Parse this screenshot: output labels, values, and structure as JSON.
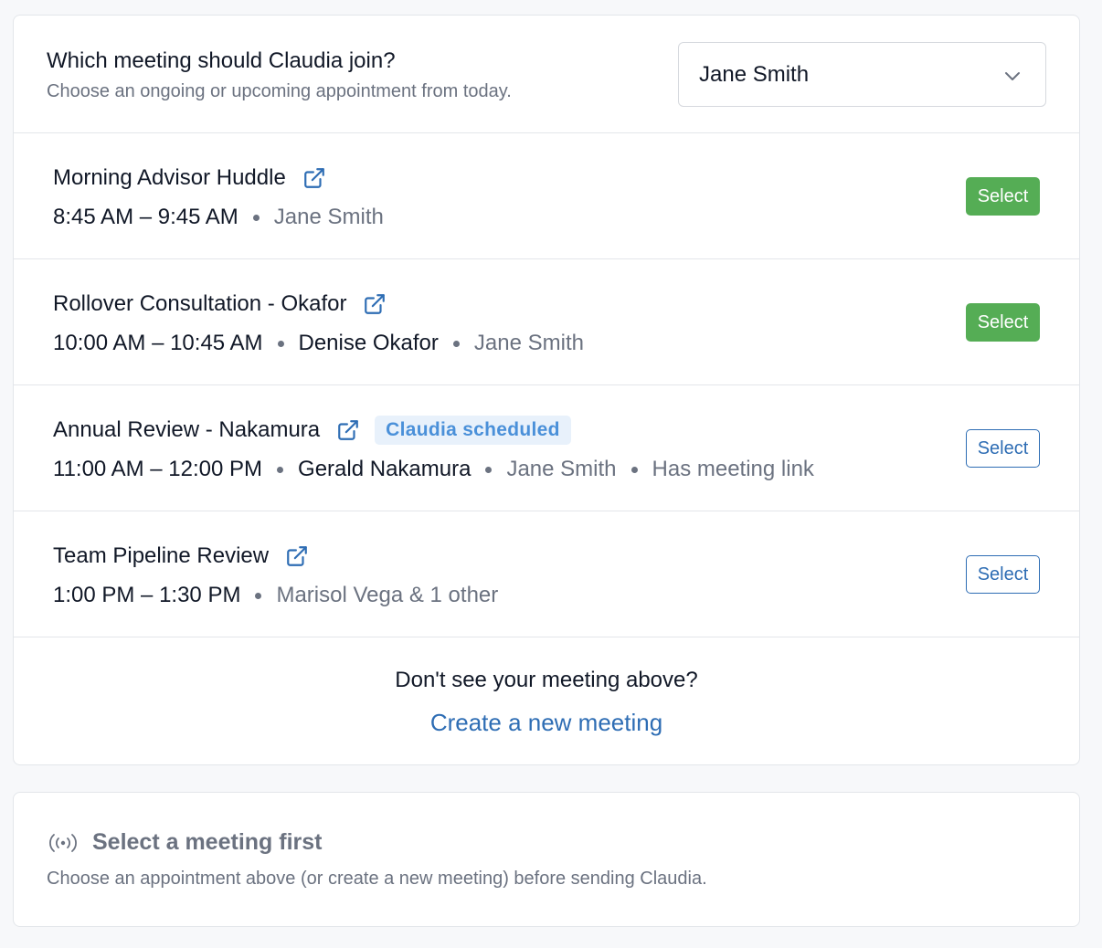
{
  "header": {
    "title": "Which meeting should Claudia join?",
    "subtitle": "Choose an ongoing or upcoming appointment from today.",
    "advisor_select": {
      "value": "Jane Smith"
    }
  },
  "meetings": [
    {
      "title": "Morning Advisor Huddle",
      "time": "8:45 AM – 9:45 AM",
      "client": "",
      "advisor": "Jane Smith",
      "badge": "",
      "extra": "",
      "button_label": "Select",
      "button_style": "solid"
    },
    {
      "title": "Rollover Consultation - Okafor",
      "time": "10:00 AM – 10:45 AM",
      "client": "Denise Okafor",
      "advisor": "Jane Smith",
      "badge": "",
      "extra": "",
      "button_label": "Select",
      "button_style": "solid"
    },
    {
      "title": "Annual Review - Nakamura",
      "time": "11:00 AM – 12:00 PM",
      "client": "Gerald Nakamura",
      "advisor": "Jane Smith",
      "badge": "Claudia scheduled",
      "extra": "Has meeting link",
      "button_label": "Select",
      "button_style": "outline"
    },
    {
      "title": "Team Pipeline Review",
      "time": "1:00 PM – 1:30 PM",
      "client": "",
      "advisor": "Marisol Vega & 1 other",
      "badge": "",
      "extra": "",
      "button_label": "Select",
      "button_style": "outline"
    }
  ],
  "footer": {
    "question": "Don't see your meeting above?",
    "create_link": "Create a new meeting"
  },
  "status": {
    "icon": "broadcast-icon",
    "title": "Select a meeting first",
    "description": "Choose an appointment above (or create a new meeting) before sending Claudia."
  },
  "colors": {
    "accent_blue": "#2e6db4",
    "select_green": "#55ad55",
    "badge_bg": "#e8f1fb",
    "badge_text": "#4a90d9",
    "muted_text": "#6b7280"
  }
}
